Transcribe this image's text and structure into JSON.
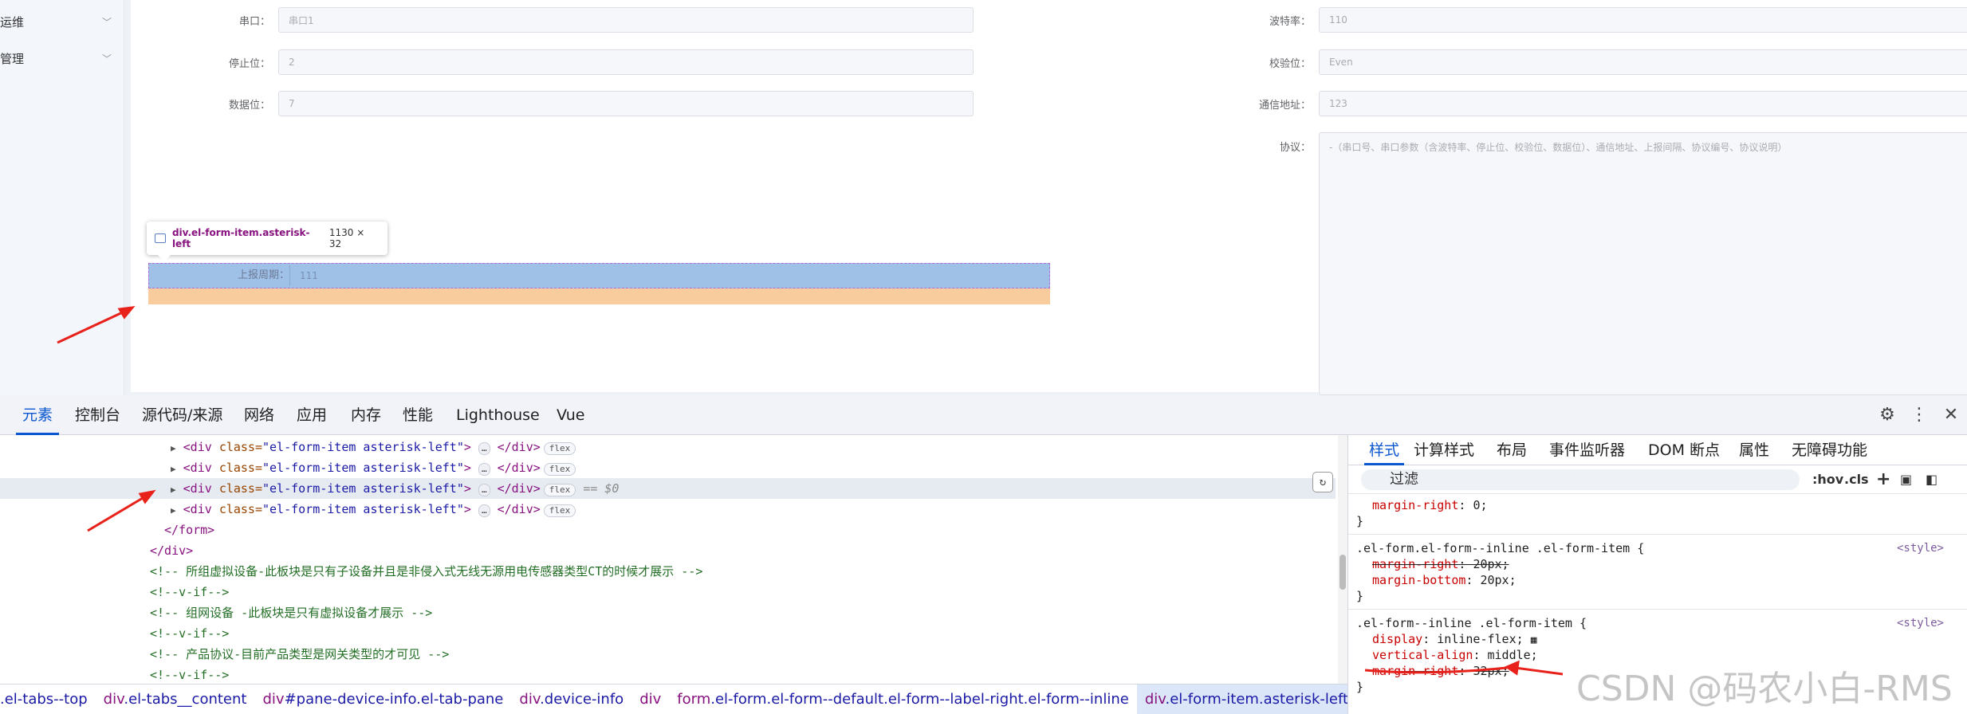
{
  "sidebar": {
    "items": [
      {
        "label": "运维"
      },
      {
        "label": "管理"
      }
    ]
  },
  "form": {
    "fields": [
      {
        "label": "串口：",
        "value": "串口1"
      },
      {
        "label": "波特率：",
        "value": "110"
      },
      {
        "label": "停止位：",
        "value": "2"
      },
      {
        "label": "校验位：",
        "value": "Even"
      },
      {
        "label": "数据位：",
        "value": "7"
      },
      {
        "label": "通信地址：",
        "value": "123"
      },
      {
        "label": "协议：",
        "value": "-（串口号、串口参数（含波特率、停止位、校验位、数据位）、通信地址、上报间隔、协议编号、协议说明）"
      },
      {
        "label": "上报周期：",
        "value": "111"
      }
    ]
  },
  "inspector": {
    "selector": "div.el-form-item.asterisk-left",
    "size": "1130 × 32"
  },
  "devtools": {
    "tabs": [
      "元素",
      "控制台",
      "源代码/来源",
      "网络",
      "应用",
      "内存",
      "性能",
      "Lighthouse",
      "Vue"
    ],
    "active_tab": "元素",
    "elements": {
      "item_tag_open": "<div ",
      "item_attr": "class=",
      "item_value": "\"el-form-item asterisk-left\"",
      "item_close": "</div>",
      "dots": "…",
      "flex_badge": "flex",
      "selected_marker": "== $0",
      "form_close": "</form>",
      "div_close": "</div>",
      "comment1": "<!-- 所组虚拟设备-此板块是只有子设备并且是非侵入式无线无源用电传感器类型CT的时候才展示 -->",
      "vif": "<!--v-if-->",
      "comment2": "<!-- 组网设备 -此板块是只有虚拟设备才展示 -->",
      "comment3": "<!-- 产品协议-目前产品类型是网关类型的才可见 -->"
    },
    "breadcrumb": [
      {
        "tag": "div",
        "rest": ".el-tabs--top"
      },
      {
        "tag": "div",
        "rest": ".el-tabs__content"
      },
      {
        "tag": "div",
        "rest": "#pane-device-info.el-tab-pane"
      },
      {
        "tag": "div",
        "rest": ".device-info"
      },
      {
        "tag": "div",
        "rest": ""
      },
      {
        "tag": "form",
        "rest": ".el-form.el-form--default.el-form--label-right.el-form--inline"
      },
      {
        "tag": "div",
        "rest": ".el-form-item.asterisk-left"
      }
    ],
    "styles": {
      "tabs": [
        "样式",
        "计算样式",
        "布局",
        "事件监听器",
        "DOM 断点",
        "属性",
        "无障碍功能"
      ],
      "filter_placeholder": "过滤",
      "hov": ":hov",
      "cls": ".cls",
      "rule0_prop": "margin-right",
      "rule0_val": "0;",
      "rule1_selector": ".el-form.el-form--inline .el-form-item {",
      "rule1_prop1": "margin-right",
      "rule1_val1": "20px;",
      "rule1_prop2": "margin-bottom",
      "rule1_val2": "20px;",
      "rule2_selector": ".el-form--inline .el-form-item {",
      "rule2_prop1": "display",
      "rule2_val1": "inline-flex;",
      "rule2_prop2": "vertical-align",
      "rule2_val2": "middle;",
      "rule2_prop3": "margin-right",
      "rule2_val3": "32px;",
      "source": "<style>",
      "close_brace": "}"
    }
  },
  "watermark": "CSDN @码农小白-RMS",
  "colors": {
    "accent": "#0b57d0",
    "highlight_content": "#9fc1e8",
    "highlight_margin": "#f9cc9d",
    "annotation": "#e8211a"
  }
}
